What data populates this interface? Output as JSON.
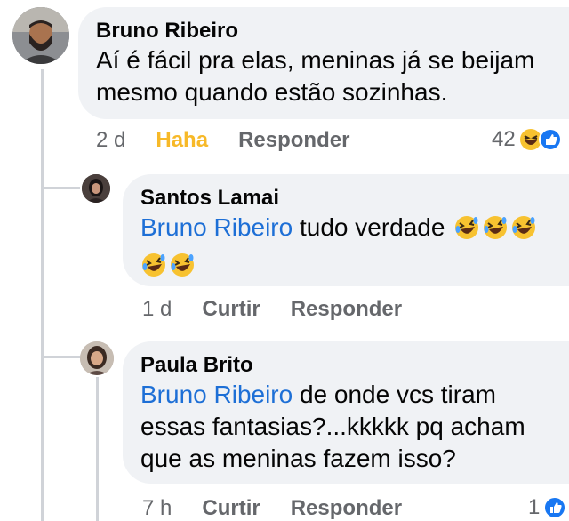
{
  "colors": {
    "bubble": "#f0f2f5",
    "mention": "#1d6fd6",
    "haha": "#f7b928",
    "muted": "#65676b",
    "like_blue": "#1877f2"
  },
  "comments": [
    {
      "author": "Bruno Ribeiro",
      "text": "Aí é fácil pra elas, meninas já se beijam mesmo quando estão sozinhas.",
      "time": "2 d",
      "reaction_label": "Haha",
      "reply_label": "Responder",
      "reaction_count": "42",
      "reaction_icons": [
        "haha-emoji-icon",
        "like-icon"
      ]
    },
    {
      "author": "Santos Lamai",
      "mention": "Bruno Ribeiro",
      "text": "tudo verdade",
      "emojis": [
        "rofl-emoji-icon",
        "rofl-emoji-icon",
        "rofl-emoji-icon",
        "rofl-emoji-icon",
        "rofl-emoji-icon"
      ],
      "time": "1 d",
      "like_label": "Curtir",
      "reply_label": "Responder"
    },
    {
      "author": "Paula Brito",
      "mention": "Bruno Ribeiro",
      "text": "de onde vcs tiram essas fantasias?...kkkkk pq acham que as meninas fazem isso?",
      "time": "7 h",
      "like_label": "Curtir",
      "reply_label": "Responder",
      "reaction_count": "1",
      "reaction_icons": [
        "like-icon"
      ]
    }
  ]
}
